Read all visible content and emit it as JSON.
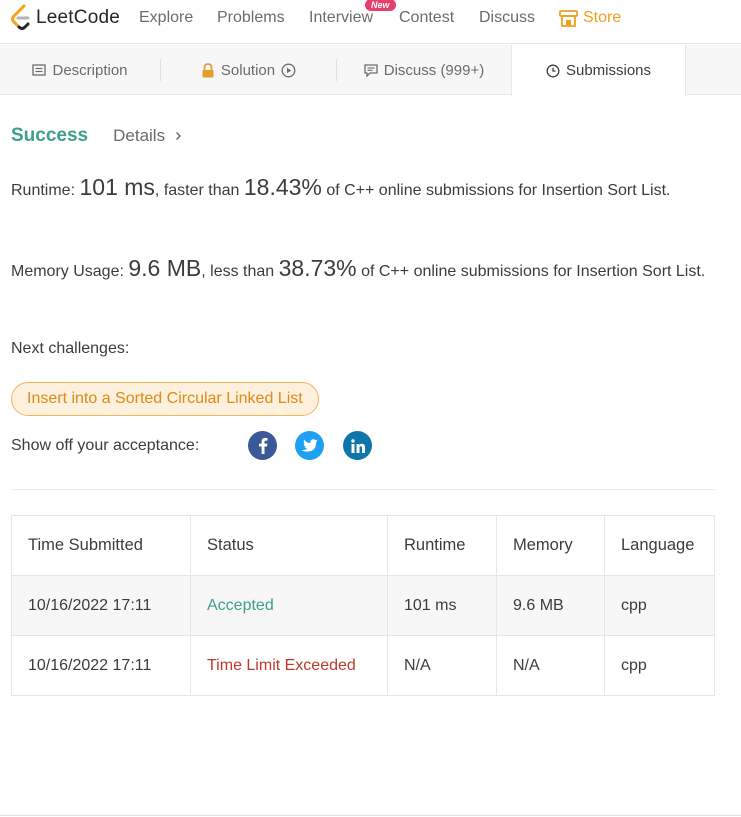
{
  "nav": {
    "logo_text": "LeetCode",
    "links": [
      {
        "label": "Explore"
      },
      {
        "label": "Problems"
      },
      {
        "label": "Interview",
        "badge": "New"
      },
      {
        "label": "Contest"
      },
      {
        "label": "Discuss"
      }
    ],
    "store_label": "Store",
    "store_color": "#f0a020"
  },
  "tabs": {
    "description": "Description",
    "solution": "Solution",
    "discuss": "Discuss (999+)",
    "submissions": "Submissions"
  },
  "result": {
    "status": "Success",
    "details_label": "Details",
    "runtime": {
      "label": "Runtime:",
      "value": "101 ms",
      "middle": ", faster than ",
      "percent": "18.43%",
      "suffix": " of C++ online submissions for Insertion Sort List."
    },
    "memory": {
      "label": "Memory Usage:",
      "value": "9.6 MB",
      "middle": ", less than ",
      "percent": "38.73%",
      "suffix": " of C++ online submissions for Insertion Sort List."
    }
  },
  "next": {
    "label": "Next challenges:",
    "challenge": "Insert into a Sorted Circular Linked List"
  },
  "share": {
    "label": "Show off your acceptance:",
    "networks": [
      "facebook-icon",
      "twitter-icon",
      "linkedin-icon"
    ]
  },
  "table": {
    "headers": [
      "Time Submitted",
      "Status",
      "Runtime",
      "Memory",
      "Language"
    ],
    "rows": [
      {
        "time": "10/16/2022 17:11",
        "status": "Accepted",
        "runtime": "101 ms",
        "memory": "9.6 MB",
        "language": "cpp"
      },
      {
        "time": "10/16/2022 17:11",
        "status": "Time Limit Exceeded",
        "runtime": "N/A",
        "memory": "N/A",
        "language": "cpp"
      }
    ]
  },
  "colors": {
    "success": "#3d9e8c",
    "error": "#c0392b",
    "challenge_bg": "#fdf0dc",
    "challenge_text": "#e08a17"
  }
}
